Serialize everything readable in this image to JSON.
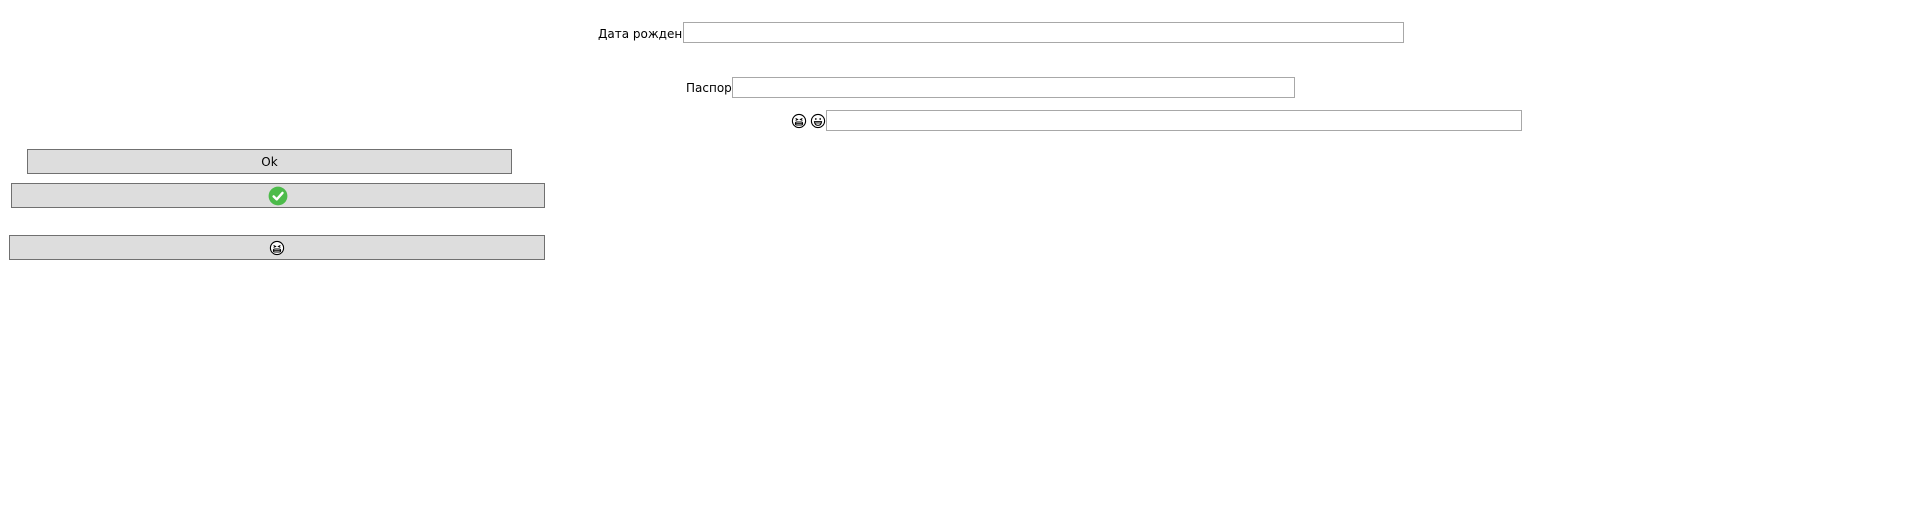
{
  "form": {
    "birth_date": {
      "label": "Дата рождения",
      "value": "",
      "placeholder": ""
    },
    "passport": {
      "label": "Паспорт",
      "value": "",
      "placeholder": ""
    },
    "emoji_field": {
      "value": "",
      "placeholder": "",
      "icons": [
        "stressed-face-icon",
        "grinning-face-icon"
      ]
    }
  },
  "buttons": {
    "ok_label": "Ok",
    "confirm_icon": "green-checkmark-icon",
    "emoji_icon": "stressed-face-icon"
  },
  "colors": {
    "button_bg": "#dddddd",
    "button_border": "#707070",
    "field_border": "#a8a8a8",
    "check_green": "#4cbb4a"
  }
}
